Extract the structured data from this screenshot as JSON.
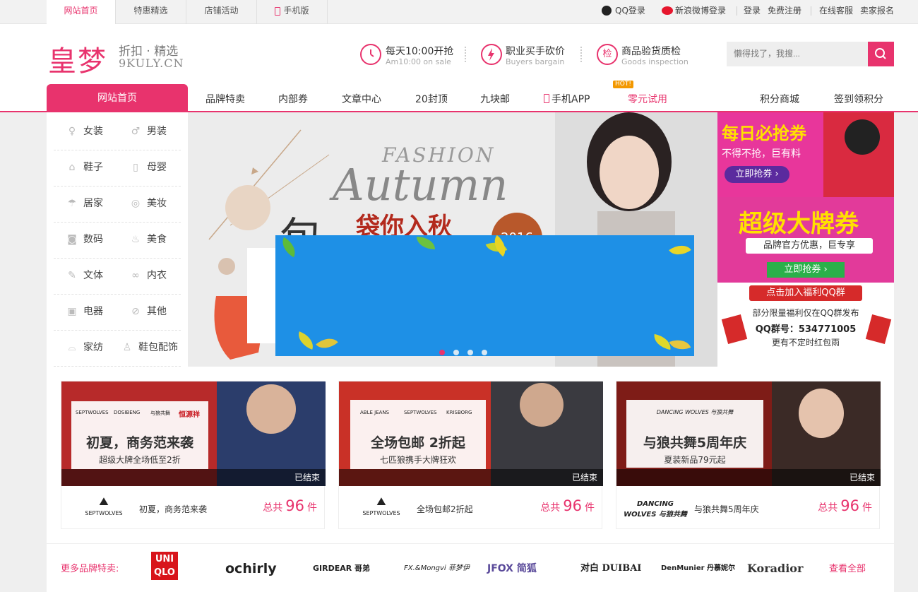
{
  "top_tabs": [
    "网站首页",
    "特惠精选",
    "店铺活动",
    "手机版"
  ],
  "top_links": [
    "QQ登录",
    "新浪微博登录",
    "登录",
    "免费注册",
    "在线客服",
    "卖家报名"
  ],
  "logo": {
    "cn": "皇梦",
    "tagline": "折扣 · 精选",
    "domain": "9KULY.CN"
  },
  "features": [
    {
      "icon": "clock-icon",
      "title": "每天10:00开抢",
      "sub": "Am10:00 on sale"
    },
    {
      "icon": "lightning-icon",
      "title": "职业买手砍价",
      "sub": "Buyers bargain"
    },
    {
      "icon": "inspect-icon",
      "glyph": "检",
      "title": "商品验货质检",
      "sub": "Goods inspection"
    }
  ],
  "search": {
    "placeholder": "懒得找了，我搜..."
  },
  "nav": {
    "active": "网站首页",
    "items": [
      "品牌特卖",
      "内部券",
      "文章中心",
      "20封顶",
      "九块邮",
      "手机APP",
      "零元试用"
    ],
    "hot_badge": "HOT!",
    "right": [
      "积分商城",
      "签到领积分"
    ]
  },
  "categories": [
    [
      "女装",
      "男装"
    ],
    [
      "鞋子",
      "母婴"
    ],
    [
      "居家",
      "美妆"
    ],
    [
      "数码",
      "美食"
    ],
    [
      "文体",
      "内衣"
    ],
    [
      "电器",
      "其他"
    ],
    [
      "家纺",
      "鞋包配饰"
    ]
  ],
  "banner": {
    "line1": "FASHION",
    "line2": "Autumn",
    "cn": "袋你入秋",
    "year": "2016",
    "big_glyph": "包"
  },
  "promos": [
    {
      "title": "每日必抢券",
      "sub": "不得不抢，巨有料",
      "btn": "立即抢券 ›"
    },
    {
      "title": "超级大牌券",
      "sub": "品牌官方优惠，巨专享",
      "btn": "立即抢券 ›"
    },
    {
      "title": "点击加入福利QQ群",
      "line1": "部分限量福利仅在QQ群发布",
      "line2": "QQ群号：534771005",
      "line3": "更有不定时红包雨"
    }
  ],
  "cards": [
    {
      "title": "初夏，商务范来袭",
      "sub": "超级大牌全场低至2折",
      "status": "已结束",
      "name": "初夏，商务范来袭",
      "total_pre": "总共",
      "count": "96",
      "unit": "件",
      "brands": [
        "SEPTWOLVES",
        "DOSIBENG",
        "与狼共舞",
        "恒源祥"
      ],
      "logo": "SEPTWOLVES"
    },
    {
      "title": "全场包邮 2折起",
      "sub": "七匹狼携手大牌狂欢",
      "status": "已结束",
      "name": "全场包邮2折起",
      "total_pre": "总共",
      "count": "96",
      "unit": "件",
      "brands": [
        "ABLE JEANS",
        "SEPTWOLVES",
        "KRISBORG"
      ],
      "logo": "SEPTWOLVES"
    },
    {
      "title": "与狼共舞5周年庆",
      "sub": "夏装新品79元起",
      "status": "已结束",
      "name": "与狼共舞5周年庆",
      "total_pre": "总共",
      "count": "96",
      "unit": "件",
      "brands": [
        "DANCING WOLVES 与狼共舞"
      ],
      "logo": "DANCING WOLVES 与狼共舞"
    }
  ],
  "brand_row": {
    "label": "更多品牌特卖:",
    "brands": [
      "UNI QLO",
      "ochirly",
      "GIRDEAR 哥弟",
      "FX.&Mongvi 菲梦伊",
      "JFOX 简狐",
      "对白 DUIBAI",
      "DenMunier 丹慕妮尔",
      "Koradior"
    ],
    "view_all": "查看全部"
  },
  "colors": {
    "accent": "#e8336d",
    "ad_blue": "#1e90e6"
  }
}
